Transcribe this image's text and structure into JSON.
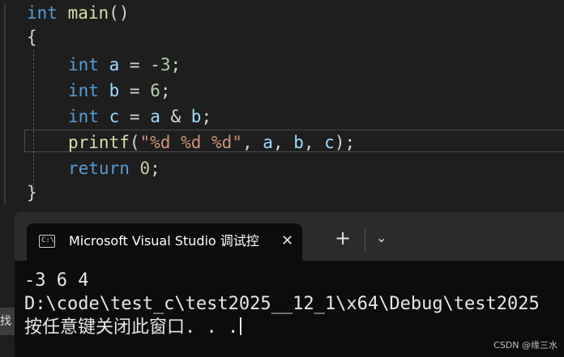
{
  "editor": {
    "code": {
      "line1": {
        "kw": "int",
        "fn": "main",
        "rest": "()"
      },
      "line2": "{",
      "line3": {
        "kw": "int",
        "var": "a",
        "op": " = -",
        "num": "3",
        "end": ";"
      },
      "line4": {
        "kw": "int",
        "var": "b",
        "op": " = ",
        "num": "6",
        "end": ";"
      },
      "line5": {
        "kw": "int",
        "var": "c",
        "op": " = ",
        "a": "a",
        "amp": " & ",
        "b": "b",
        "end": ";"
      },
      "line6": {
        "fn": "printf",
        "open": "(",
        "str": "\"%d %d %d\"",
        "sep1": ", ",
        "a": "a",
        "sep2": ", ",
        "b": "b",
        "sep3": ", ",
        "c": "c",
        "end": ");"
      },
      "line7": {
        "kw": "return",
        "num": "0",
        "end": ";"
      },
      "line8": "}"
    }
  },
  "terminal": {
    "tab_title": "Microsoft Visual Studio 调试控",
    "tab_close": "✕",
    "new_tab": "+",
    "dropdown": "⌄",
    "icon_glyph": "C:\\",
    "output": [
      "-3 6 4",
      "D:\\code\\test_c\\test2025__12_1\\x64\\Debug\\test2025",
      "按任意键关闭此窗口. . ."
    ]
  },
  "left_sliver_text": "找",
  "watermark": "CSDN @缘三水",
  "colors": {
    "keyword": "#569cd6",
    "function": "#dcdcaa",
    "variable": "#9cdcfe",
    "number": "#b5cea8",
    "string": "#ce9178"
  }
}
